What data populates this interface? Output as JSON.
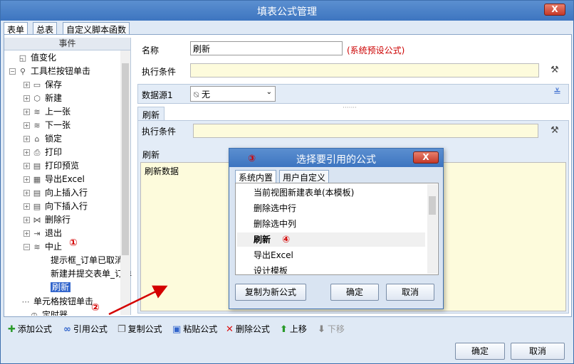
{
  "window": {
    "title": "填表公式管理",
    "close_label": "X"
  },
  "tabs": [
    "表单",
    "总表",
    "自定义脚本函数"
  ],
  "tree": {
    "header": "事件",
    "items": [
      {
        "label": "值变化",
        "icon": "value-change-icon",
        "glyph": "◱"
      },
      {
        "label": "工具栏按钮单击",
        "icon": "toolbar-click-icon",
        "glyph": "⚲"
      },
      {
        "label": "保存",
        "icon": "save-icon",
        "glyph": "▭"
      },
      {
        "label": "新建",
        "icon": "new-icon",
        "glyph": "⬡"
      },
      {
        "label": "上一张",
        "icon": "prev-icon",
        "glyph": "≋"
      },
      {
        "label": "下一张",
        "icon": "next-icon",
        "glyph": "≋"
      },
      {
        "label": "锁定",
        "icon": "lock-icon",
        "glyph": "⌂"
      },
      {
        "label": "打印",
        "icon": "print-icon",
        "glyph": "⎙"
      },
      {
        "label": "打印预览",
        "icon": "print-preview-icon",
        "glyph": "▤"
      },
      {
        "label": "导出Excel",
        "icon": "excel-icon",
        "glyph": "▦"
      },
      {
        "label": "向上插入行",
        "icon": "insert-up-icon",
        "glyph": "▤"
      },
      {
        "label": "向下插入行",
        "icon": "insert-down-icon",
        "glyph": "▤"
      },
      {
        "label": "删除行",
        "icon": "delete-row-icon",
        "glyph": "⋈"
      },
      {
        "label": "退出",
        "icon": "exit-icon",
        "glyph": "⇥"
      },
      {
        "label": "中止",
        "icon": "abort-icon",
        "glyph": "≋"
      },
      {
        "label": "提示框_订单已取消",
        "icon": "",
        "glyph": ""
      },
      {
        "label": "新建并提交表单_订单",
        "icon": "",
        "glyph": ""
      },
      {
        "label": "刷新",
        "icon": "",
        "glyph": ""
      },
      {
        "label": "单元格按钮单击",
        "icon": "",
        "glyph": ""
      },
      {
        "label": "定时器",
        "icon": "timer-icon",
        "glyph": "◷"
      }
    ]
  },
  "form": {
    "name_label": "名称",
    "name_value": "刷新",
    "system_note": "(系统预设公式)",
    "condition_label": "执行条件",
    "datasource_label": "数据源1",
    "datasource_value": "无",
    "sub_tab": "刷新",
    "sub_condition_label": "执行条件",
    "body_label": "刷新",
    "body_text": "刷新数据"
  },
  "toolbar": {
    "add": "添加公式",
    "ref": "引用公式",
    "copy": "复制公式",
    "paste": "粘贴公式",
    "delete": "删除公式",
    "up": "上移",
    "down": "下移"
  },
  "footer": {
    "ok": "确定",
    "cancel": "取消"
  },
  "dialog": {
    "title": "选择要引用的公式",
    "close_label": "X",
    "tabs": [
      "系统内置",
      "用户自定义"
    ],
    "items": [
      "当前视图新建表单(本模板)",
      "删除选中行",
      "删除选中列",
      "刷新",
      "导出Excel",
      "设计模板"
    ],
    "copy_btn": "复制为新公式",
    "ok": "确定",
    "cancel": "取消"
  },
  "annotations": [
    "①",
    "②",
    "③",
    "④"
  ]
}
